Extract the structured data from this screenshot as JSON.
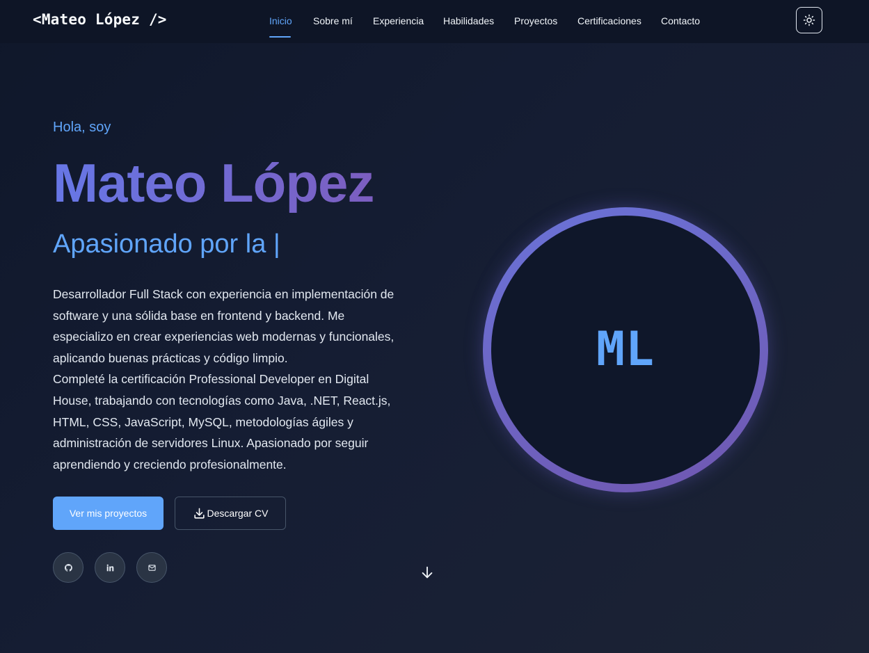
{
  "header": {
    "logo": "<Mateo López />",
    "nav": [
      {
        "label": "Inicio",
        "active": true
      },
      {
        "label": "Sobre mí"
      },
      {
        "label": "Experiencia"
      },
      {
        "label": "Habilidades"
      },
      {
        "label": "Proyectos"
      },
      {
        "label": "Certificaciones"
      },
      {
        "label": "Contacto"
      }
    ],
    "theme_toggle_icon": "sun-icon"
  },
  "hero": {
    "greeting": "Hola, soy",
    "name": "Mateo López",
    "tagline": "Apasionado por la |",
    "bio": [
      "Desarrollador Full Stack con experiencia en implementación de software y una sólida base en frontend y backend. Me especializo en crear experiencias web modernas y funcionales, aplicando buenas prácticas y código limpio.",
      "Completé la certificación Professional Developer en Digital House, trabajando con tecnologías como Java, .NET, React.js, HTML, CSS, JavaScript, MySQL, metodologías ágiles y administración de servidores Linux. Apasionado por seguir aprendiendo y creciendo profesionalmente."
    ],
    "primary_button": "Ver mis proyectos",
    "secondary_button": "Descargar CV",
    "secondary_button_icon": "download-icon",
    "social": [
      "github-icon",
      "linkedin-icon",
      "mail-icon"
    ],
    "scroll_icon": "arrow-down-icon",
    "avatar_initials": "ML"
  },
  "colors": {
    "accent": "#60a5fa",
    "name_gradient_start": "#6777e6",
    "name_gradient_end": "#7c5ec0",
    "background": "#0f172a"
  }
}
